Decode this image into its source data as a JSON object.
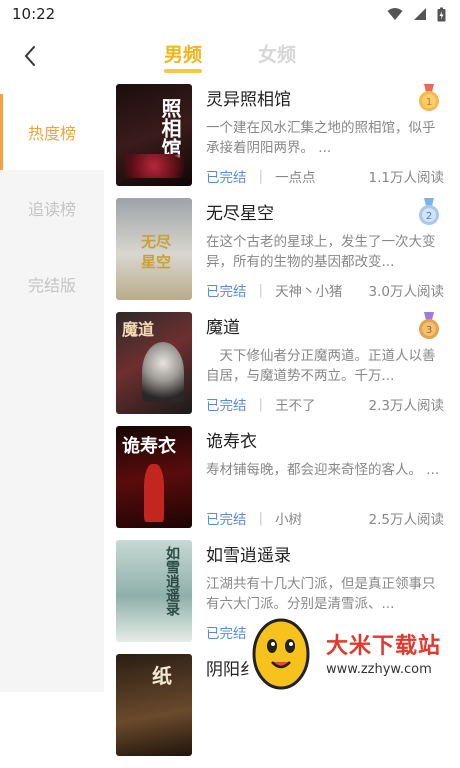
{
  "status_bar": {
    "time": "10:22"
  },
  "header": {
    "back_icon": "back-arrow-icon",
    "tabs": [
      {
        "label": "男频",
        "active": true
      },
      {
        "label": "女频",
        "active": false
      }
    ]
  },
  "sidebar": {
    "items": [
      {
        "label": "热度榜",
        "active": true
      },
      {
        "label": "追读榜",
        "active": false
      },
      {
        "label": "完结版",
        "active": false
      }
    ]
  },
  "books": [
    {
      "title": "灵异照相馆",
      "desc": "一个建在风水汇集之地的照相馆，似乎承接着阴阳两界。 ...",
      "status": "已完结",
      "author": "一点点",
      "reads": "1.1万人阅读",
      "rank_badge": "1",
      "cover_text": "照相馆"
    },
    {
      "title": "无尽星空",
      "desc": "在这个古老的星球上，发生了一次大变异，所有的生物的基因都改变...",
      "status": "已完结",
      "author": "天神丶小猪",
      "reads": "3.0万人阅读",
      "rank_badge": "2",
      "cover_text": "无尽星空"
    },
    {
      "title": "魔道",
      "desc": "　天下修仙者分正魔两道。正道人以善自居，与魔道势不两立。千万...",
      "status": "已完结",
      "author": "王不了",
      "reads": "2.3万人阅读",
      "rank_badge": "3",
      "cover_text": "魔道"
    },
    {
      "title": "诡寿衣",
      "desc": "寿材铺每晚，都会迎来奇怪的客人。 ...",
      "status": "已完结",
      "author": "小树",
      "reads": "2.5万人阅读",
      "rank_badge": "",
      "cover_text": "诡寿衣"
    },
    {
      "title": "如雪逍遥录",
      "desc": "江湖共有十几大门派，但是真正领事只有六大门派。分别是清雪派、...",
      "status": "已完结",
      "author": "",
      "reads": "",
      "rank_badge": "",
      "cover_text": "如雪逍遥录"
    },
    {
      "title": "阴阳纟",
      "desc": "",
      "status": "",
      "author": "",
      "reads": "",
      "rank_badge": "",
      "cover_text": "纸"
    }
  ],
  "watermark": {
    "brand": "大米下载站",
    "url": "www.zzhyw.com"
  },
  "colors": {
    "accent": "#f2b51a",
    "status_blue": "#5b8bd8",
    "sidebar_active": "#f0a33e"
  }
}
